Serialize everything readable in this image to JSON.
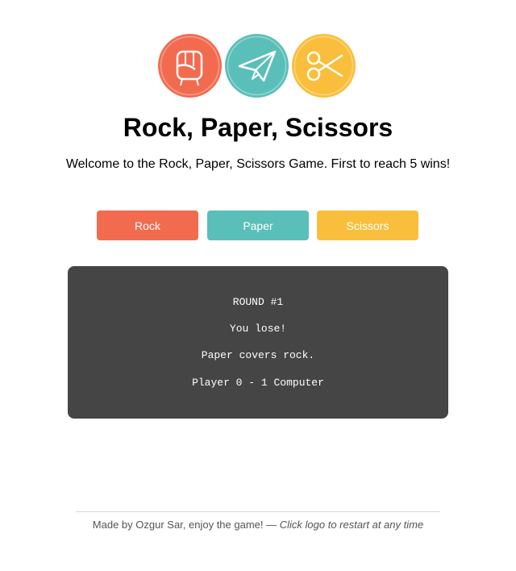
{
  "logo": {
    "icons": [
      "fist-icon",
      "paper-plane-icon",
      "scissors-icon"
    ],
    "colors": [
      "#f26b4f",
      "#5bbfb9",
      "#f9bf3c"
    ]
  },
  "header": {
    "title": "Rock, Paper, Scissors",
    "subtitle": "Welcome to the Rock, Paper, Scissors Game. First to reach 5 wins!"
  },
  "choices": [
    {
      "label": "Rock",
      "color": "#f26b4f"
    },
    {
      "label": "Paper",
      "color": "#5bbfb9"
    },
    {
      "label": "Scissors",
      "color": "#f9bf3c"
    }
  ],
  "result": {
    "round": "ROUND #1",
    "outcome": "You lose!",
    "reason": "Paper covers rock.",
    "score": "Player 0 - 1 Computer",
    "player_score": 0,
    "computer_score": 1
  },
  "footer": {
    "credit": "Made by Ozgur Sar, enjoy the game! — ",
    "hint": "Click logo to restart at any time"
  }
}
